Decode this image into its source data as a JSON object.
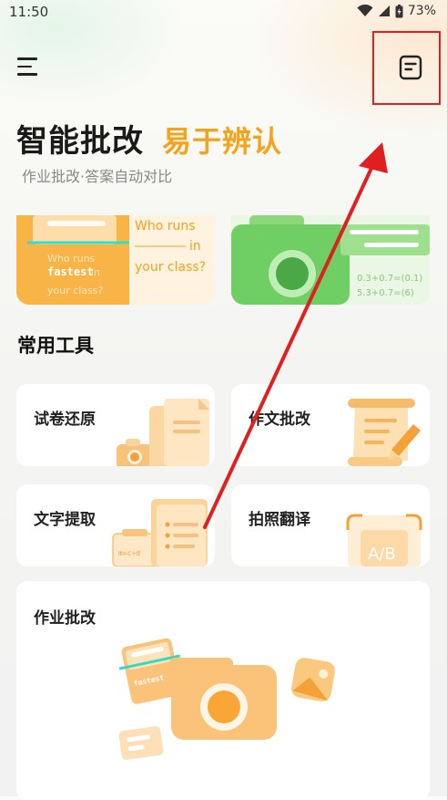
{
  "status": {
    "time": "11:50",
    "battery": "73%"
  },
  "header": {
    "menu_icon": "hamburger-menu-icon",
    "record_icon": "document-record-icon"
  },
  "hero": {
    "title_main": "智能批改",
    "title_accent": "易于辨认",
    "subtitle": "作业批改·答案自动对比",
    "accent_color": "#f5a21c"
  },
  "banners": {
    "left": {
      "headline": "Who runs",
      "word_in": "in",
      "headline2": "your class?",
      "card_line1": "Who runs",
      "card_word": "fastest",
      "card_word_in": "in",
      "card_line3": "your class?"
    },
    "right": {
      "eq1": "0.3+0.7=(0.1)",
      "eq2": "5.3+0.7=(6)"
    }
  },
  "tools": {
    "section_title": "常用工具",
    "items": [
      {
        "label": "试卷还原"
      },
      {
        "label": "作文批改"
      },
      {
        "label": "文字提取"
      },
      {
        "label": "拍照翻译"
      }
    ],
    "big": {
      "label": "作业批改",
      "card_text": "fastest"
    }
  },
  "annotation": {
    "color": "#e02020"
  }
}
